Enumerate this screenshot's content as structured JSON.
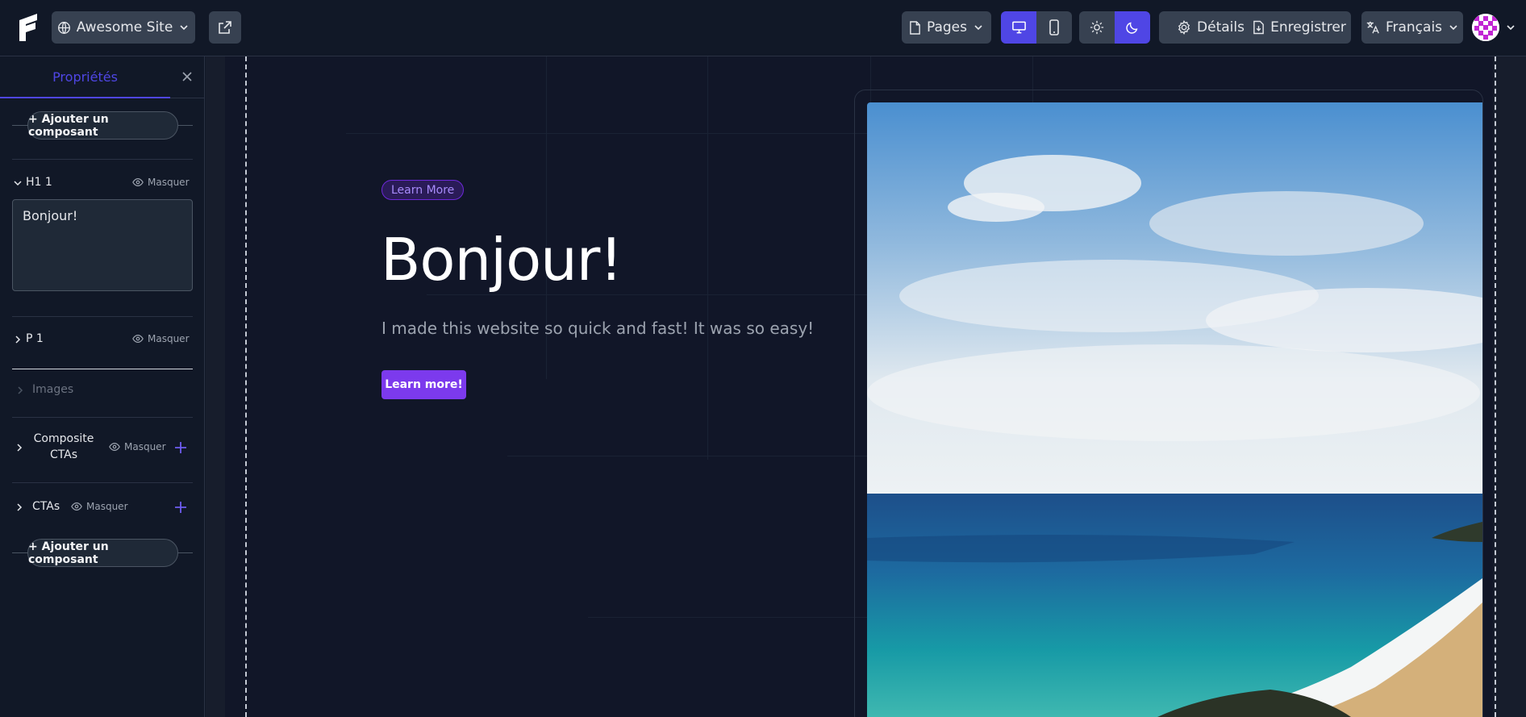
{
  "topbar": {
    "site_name": "Awesome Site",
    "pages_label": "Pages",
    "details_label": "Détails",
    "save_label": "Enregistrer",
    "language_label": "Français"
  },
  "sidebar": {
    "tab_properties": "Propriétés",
    "add_component_label": "+ Ajouter un composant",
    "hide_label": "Masquer",
    "sections": {
      "h1": "H1 1",
      "p": "P 1",
      "images": "Images",
      "composite_ctas": "Composite CTAs",
      "ctas": "CTAs"
    },
    "h1_value": "Bonjour!"
  },
  "hero": {
    "badge": "Learn More",
    "title": "Bonjour!",
    "subtitle": "I made this website so quick and fast! It was so easy!",
    "cta": "Learn more!"
  },
  "colors": {
    "accent": "#4f46e5",
    "cta": "#7c3aed",
    "background": "#111827",
    "surface": "#374151"
  }
}
